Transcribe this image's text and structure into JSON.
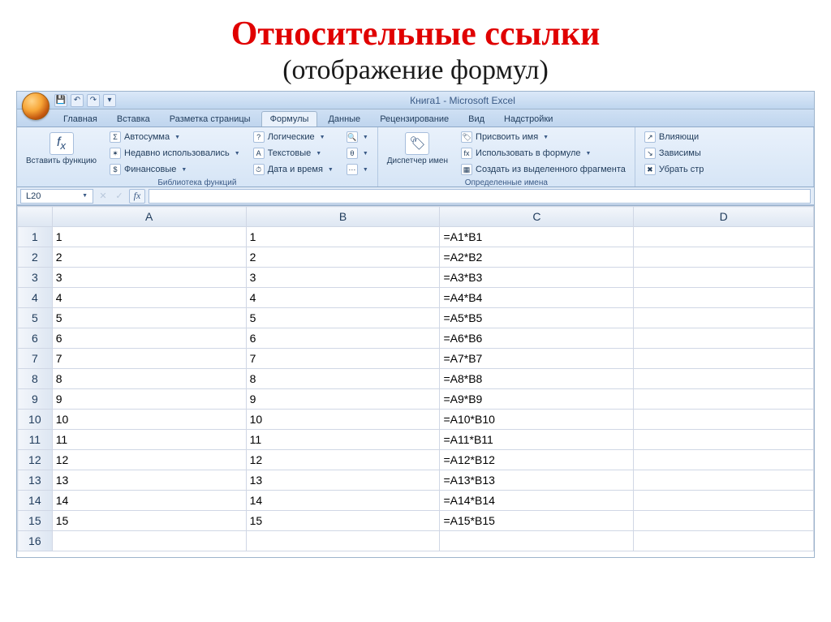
{
  "slide": {
    "title": "Относительные ссылки",
    "subtitle": "(отображение формул)"
  },
  "window": {
    "title": "Книга1 - Microsoft Excel"
  },
  "tabs": {
    "items": [
      "Главная",
      "Вставка",
      "Разметка страницы",
      "Формулы",
      "Данные",
      "Рецензирование",
      "Вид",
      "Надстройки"
    ],
    "active_index": 3
  },
  "ribbon": {
    "group1": {
      "label": "Библиотека функций",
      "insert_fn": "Вставить функцию",
      "autosum": "Автосумма",
      "recent": "Недавно использовались",
      "financial": "Финансовые",
      "logical": "Логические",
      "text": "Текстовые",
      "datetime": "Дата и время"
    },
    "group2": {
      "label": "Определенные имена",
      "name_mgr": "Диспетчер имен",
      "define": "Присвоить имя",
      "use_in_formula": "Использовать в формуле",
      "create_from_sel": "Создать из выделенного фрагмента"
    },
    "group3": {
      "trace_prec": "Влияющи",
      "trace_dep": "Зависимы",
      "remove_arrows": "Убрать стр"
    }
  },
  "formula_bar": {
    "namebox": "L20",
    "fx": "fx",
    "value": ""
  },
  "columns": [
    "A",
    "B",
    "C",
    "D"
  ],
  "rows": [
    {
      "n": "1",
      "A": "1",
      "B": "1",
      "C": "=A1*B1"
    },
    {
      "n": "2",
      "A": "2",
      "B": "2",
      "C": "=A2*B2"
    },
    {
      "n": "3",
      "A": "3",
      "B": "3",
      "C": "=A3*B3"
    },
    {
      "n": "4",
      "A": "4",
      "B": "4",
      "C": "=A4*B4"
    },
    {
      "n": "5",
      "A": "5",
      "B": "5",
      "C": "=A5*B5"
    },
    {
      "n": "6",
      "A": "6",
      "B": "6",
      "C": "=A6*B6"
    },
    {
      "n": "7",
      "A": "7",
      "B": "7",
      "C": "=A7*B7"
    },
    {
      "n": "8",
      "A": "8",
      "B": "8",
      "C": "=A8*B8"
    },
    {
      "n": "9",
      "A": "9",
      "B": "9",
      "C": "=A9*B9"
    },
    {
      "n": "10",
      "A": "10",
      "B": "10",
      "C": "=A10*B10"
    },
    {
      "n": "11",
      "A": "11",
      "B": "11",
      "C": "=A11*B11"
    },
    {
      "n": "12",
      "A": "12",
      "B": "12",
      "C": "=A12*B12"
    },
    {
      "n": "13",
      "A": "13",
      "B": "13",
      "C": "=A13*B13"
    },
    {
      "n": "14",
      "A": "14",
      "B": "14",
      "C": "=A14*B14"
    },
    {
      "n": "15",
      "A": "15",
      "B": "15",
      "C": "=A15*B15"
    },
    {
      "n": "16",
      "A": "",
      "B": "",
      "C": ""
    }
  ]
}
